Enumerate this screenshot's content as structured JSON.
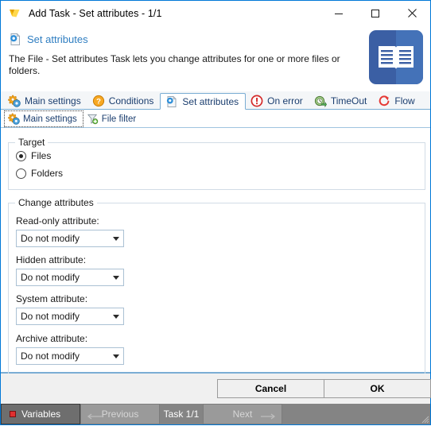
{
  "window": {
    "title": "Add Task - Set attributes - 1/1",
    "icon": "app-logo-icon",
    "controls": {
      "minimize": "minimize-icon",
      "maximize": "maximize-icon",
      "close": "close-icon"
    }
  },
  "header": {
    "icon": "set-attributes-icon",
    "title": "Set attributes",
    "description": "The File - Set attributes Task lets you change attributes for one or more files or folders.",
    "badge_icon": "book-icon"
  },
  "tabs": [
    {
      "label": "Main settings",
      "icon": "gears-icon",
      "active": false
    },
    {
      "label": "Conditions",
      "icon": "question-icon",
      "active": false
    },
    {
      "label": "Set attributes",
      "icon": "set-attributes-icon",
      "active": true
    },
    {
      "label": "On error",
      "icon": "error-icon",
      "active": false
    },
    {
      "label": "TimeOut",
      "icon": "timeout-icon",
      "active": false
    },
    {
      "label": "Flow",
      "icon": "flow-icon",
      "active": false
    }
  ],
  "subtabs": [
    {
      "label": "Main settings",
      "icon": "gears-icon",
      "active": true
    },
    {
      "label": "File filter",
      "icon": "filter-add-icon",
      "active": false
    }
  ],
  "form": {
    "target_group": {
      "legend": "Target",
      "options": [
        {
          "label": "Files",
          "checked": true
        },
        {
          "label": "Folders",
          "checked": false
        }
      ]
    },
    "change_group": {
      "legend": "Change attributes",
      "fields": [
        {
          "label": "Read-only attribute:",
          "value": "Do not modify"
        },
        {
          "label": "Hidden attribute:",
          "value": "Do not modify"
        },
        {
          "label": "System attribute:",
          "value": "Do not modify"
        },
        {
          "label": "Archive attribute:",
          "value": "Do not modify"
        }
      ]
    }
  },
  "buttons": {
    "cancel": "Cancel",
    "ok": "OK"
  },
  "statusbar": {
    "variables": "Variables",
    "previous": "Previous",
    "task": "Task 1/1",
    "next": "Next",
    "prev_icon": "arrow-left-icon",
    "next_icon": "arrow-right-icon",
    "resize_grip": "resize-grip-icon"
  },
  "colors": {
    "accent": "#0078d7",
    "tab_text": "#1b3e6f",
    "header_title": "#2f7ec1",
    "badge_dark": "#3b5fa4",
    "badge_light": "#4472b8",
    "statusbar": "#848484"
  }
}
